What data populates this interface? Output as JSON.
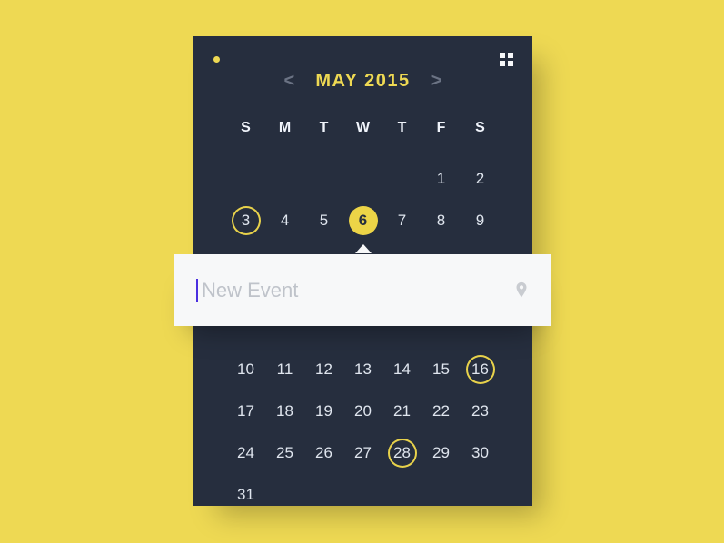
{
  "colors": {
    "bg": "#eed953",
    "card": "#262e3e",
    "accent": "#eed953",
    "caret": "#4b2fe0"
  },
  "header": {
    "month_year": "MAY 2015",
    "prev_glyph": "<",
    "next_glyph": ">"
  },
  "weekdays": [
    "S",
    "M",
    "T",
    "W",
    "T",
    "F",
    "S"
  ],
  "days": {
    "blank_leading": 5,
    "count": 31,
    "selected": 6,
    "circled": [
      3,
      16,
      28
    ]
  },
  "event": {
    "value": "",
    "placeholder": "New Event"
  },
  "icons": {
    "status_dot": "status-dot",
    "grid": "grid-icon",
    "location": "location-pin-icon",
    "chev_left": "chevron-left-icon",
    "chev_right": "chevron-right-icon"
  }
}
